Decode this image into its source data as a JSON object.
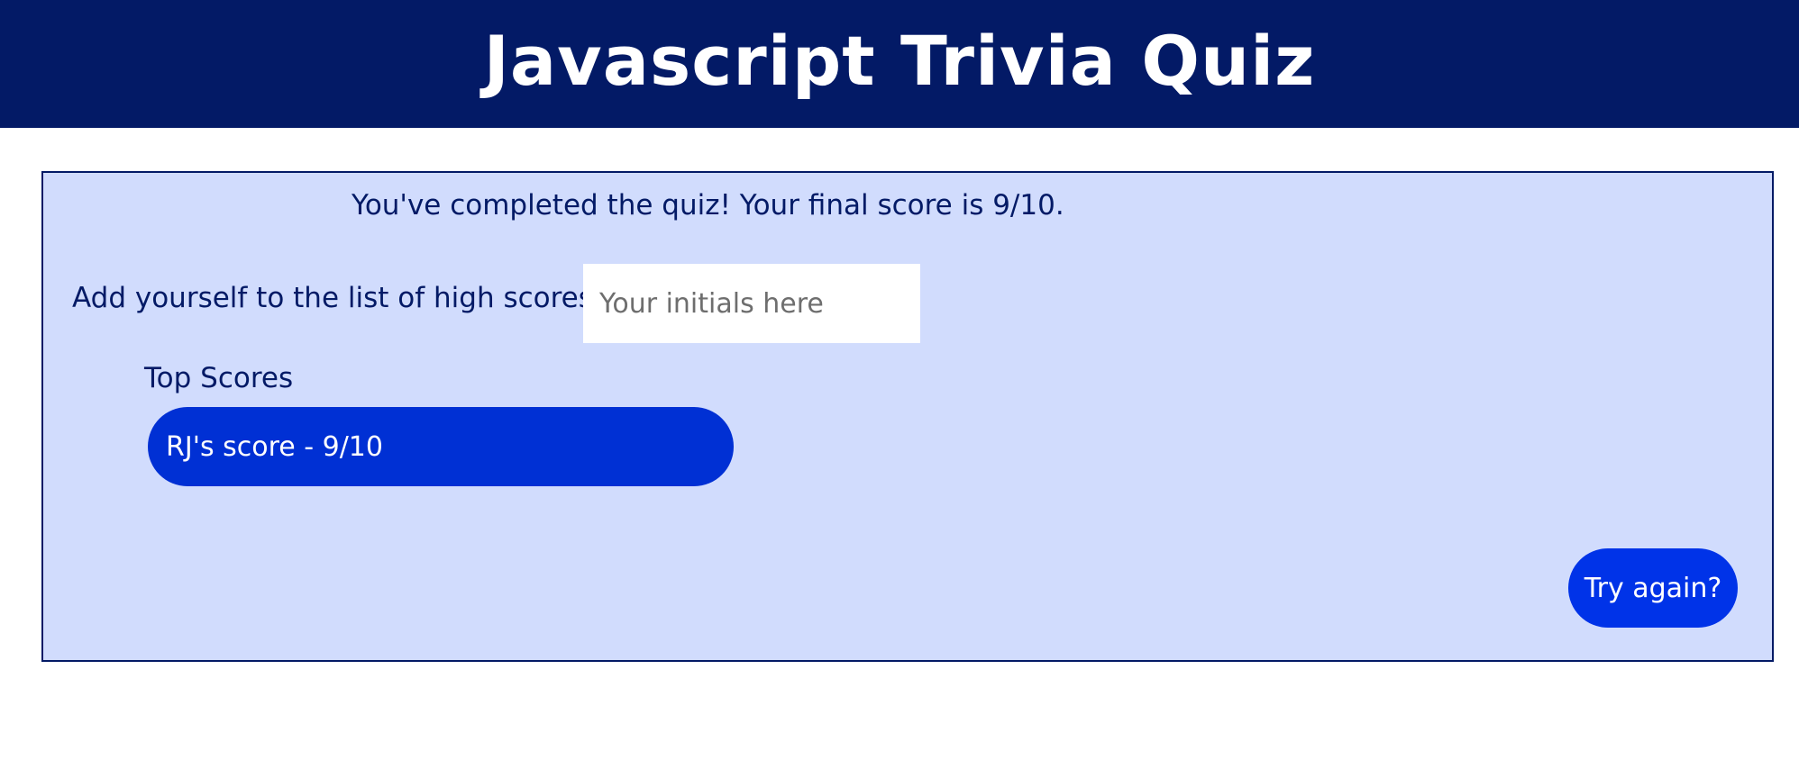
{
  "header": {
    "title": "Javascript Trivia Quiz"
  },
  "results": {
    "final_message": "You've completed the quiz! Your final score is 9/10.",
    "add_label": "Add yourself to the list of high scores",
    "initials_placeholder": "Your initials here",
    "initials_value": ""
  },
  "top_scores": {
    "label": "Top Scores",
    "items": [
      {
        "text": "RJ's score - 9/10"
      }
    ]
  },
  "actions": {
    "try_again_label": "Try again?"
  },
  "colors": {
    "header_bg": "#031a66",
    "panel_bg": "#d1dcfd",
    "score_pill": "#0030d4",
    "button": "#0033e8"
  }
}
